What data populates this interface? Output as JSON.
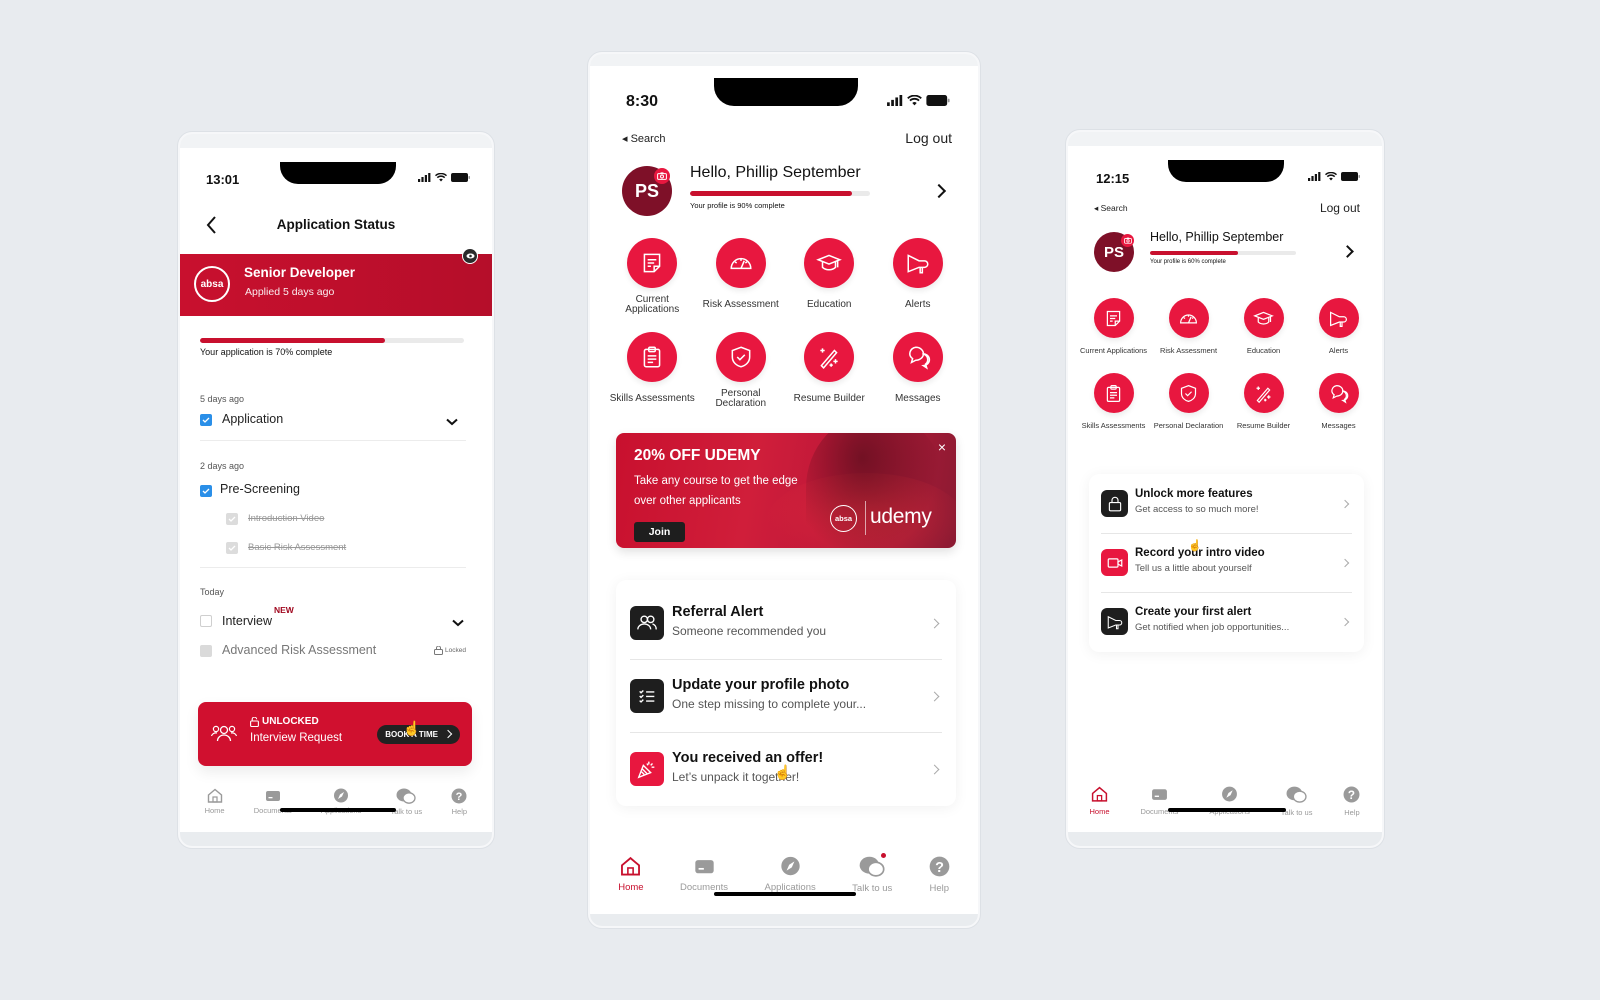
{
  "colors": {
    "brand_red": "#c8102e",
    "icon_red": "#e8173f",
    "avatar_maroon": "#7e1028",
    "checkbox_blue": "#2a8fe8",
    "background": "#e8ebef"
  },
  "application_status_screen": {
    "status_bar": {
      "time": "13:01"
    },
    "nav": {
      "title": "Application Status",
      "back_icon": "chevron-left-icon"
    },
    "job": {
      "company_logo_text": "absa",
      "title": "Senior Developer",
      "applied": "Applied 5 days ago",
      "eye_icon": "eye-icon"
    },
    "progress": {
      "percent": 70,
      "caption": "Your application is 70% complete"
    },
    "sections": [
      {
        "label": "5 days ago",
        "steps": [
          {
            "label": "Application",
            "state": "checked",
            "expandable": true
          }
        ]
      },
      {
        "label": "2 days ago",
        "steps": [
          {
            "label": "Pre-Screening",
            "state": "checked",
            "expandable": false,
            "sub_steps": [
              {
                "label": "Introduction Video",
                "state": "done"
              },
              {
                "label": "Basic Risk Assessment",
                "state": "done"
              }
            ]
          }
        ]
      },
      {
        "label": "Today",
        "steps": [
          {
            "label": "Interview",
            "state": "unchecked",
            "badge": "NEW",
            "expandable": true
          },
          {
            "label": "Advanced Risk Assessment",
            "state": "locked",
            "lock_label": "Locked"
          }
        ]
      }
    ],
    "unlock_card": {
      "heading": "UNLOCKED",
      "subtitle": "Interview Request",
      "button": "BOOK A TIME"
    },
    "tabbar": [
      {
        "label": "Home",
        "icon": "home-icon",
        "active": false
      },
      {
        "label": "Documents",
        "icon": "documents-icon",
        "active": false
      },
      {
        "label": "Applications",
        "icon": "applications-icon",
        "active": false
      },
      {
        "label": "Talk to us",
        "icon": "chat-icon",
        "active": false
      },
      {
        "label": "Help",
        "icon": "help-icon",
        "active": false
      }
    ]
  },
  "home_screen_main": {
    "status_bar": {
      "time": "8:30"
    },
    "search_back": "◂ Search",
    "logout": "Log out",
    "profile": {
      "initials": "PS",
      "greeting": "Hello, Phillip September",
      "percent": 90,
      "caption": "Your profile is 90% complete"
    },
    "grid": [
      {
        "label": "Current Applications",
        "icon": "document-icon"
      },
      {
        "label": "Risk Assessment",
        "icon": "gauge-icon"
      },
      {
        "label": "Education",
        "icon": "graduation-cap-icon"
      },
      {
        "label": "Alerts",
        "icon": "megaphone-icon"
      },
      {
        "label": "Skills Assessments",
        "icon": "clipboard-icon"
      },
      {
        "label": "Personal Declaration",
        "icon": "shield-check-icon"
      },
      {
        "label": "Resume Builder",
        "icon": "magic-wand-icon"
      },
      {
        "label": "Messages",
        "icon": "chat-bubbles-icon"
      }
    ],
    "promo": {
      "title": "20% OFF UDEMY",
      "text": "Take any course to get the edge over other applicants",
      "button": "Join",
      "close": "×",
      "logo_text": "absa",
      "partner": "udemy"
    },
    "cards": [
      {
        "title": "Referral Alert",
        "subtitle": "Someone recommended you",
        "icon": "people-icon",
        "accent": false
      },
      {
        "title": "Update your profile photo",
        "subtitle": "One step missing to complete your...",
        "icon": "checklist-icon",
        "accent": false
      },
      {
        "title": "You received an offer!",
        "subtitle": "Let’s unpack it together!",
        "icon": "party-popper-icon",
        "accent": true
      }
    ],
    "tabbar": [
      {
        "label": "Home",
        "icon": "home-icon",
        "active": true
      },
      {
        "label": "Documents",
        "icon": "documents-icon",
        "active": false
      },
      {
        "label": "Applications",
        "icon": "applications-icon",
        "active": false
      },
      {
        "label": "Talk to us",
        "icon": "chat-icon",
        "active": false,
        "notification_dot": true
      },
      {
        "label": "Help",
        "icon": "help-icon",
        "active": false
      }
    ]
  },
  "home_screen_alt": {
    "status_bar": {
      "time": "12:15"
    },
    "search_back": "◂ Search",
    "logout": "Log out",
    "profile": {
      "initials": "PS",
      "greeting": "Hello, Phillip September",
      "percent": 60,
      "caption": "Your profile is 60% complete"
    },
    "grid": [
      {
        "label": "Current Applications",
        "icon": "document-icon"
      },
      {
        "label": "Risk Assessment",
        "icon": "gauge-icon"
      },
      {
        "label": "Education",
        "icon": "graduation-cap-icon"
      },
      {
        "label": "Alerts",
        "icon": "megaphone-icon"
      },
      {
        "label": "Skills Assessments",
        "icon": "clipboard-icon"
      },
      {
        "label": "Personal Declaration",
        "icon": "shield-check-icon"
      },
      {
        "label": "Resume Builder",
        "icon": "magic-wand-icon"
      },
      {
        "label": "Messages",
        "icon": "chat-bubbles-icon"
      }
    ],
    "cards": [
      {
        "title": "Unlock more features",
        "subtitle": "Get access to so much more!",
        "icon": "lock-icon",
        "accent": false
      },
      {
        "title": "Record your intro video",
        "subtitle": "Tell us a little about yourself",
        "icon": "video-camera-icon",
        "accent": true
      },
      {
        "title": "Create your first alert",
        "subtitle": "Get notified when job opportunities...",
        "icon": "megaphone-icon",
        "accent": false
      }
    ],
    "tabbar": [
      {
        "label": "Home",
        "icon": "home-icon",
        "active": true
      },
      {
        "label": "Documents",
        "icon": "documents-icon",
        "active": false
      },
      {
        "label": "Applications",
        "icon": "applications-icon",
        "active": false
      },
      {
        "label": "Talk to us",
        "icon": "chat-icon",
        "active": false
      },
      {
        "label": "Help",
        "icon": "help-icon",
        "active": false
      }
    ]
  }
}
